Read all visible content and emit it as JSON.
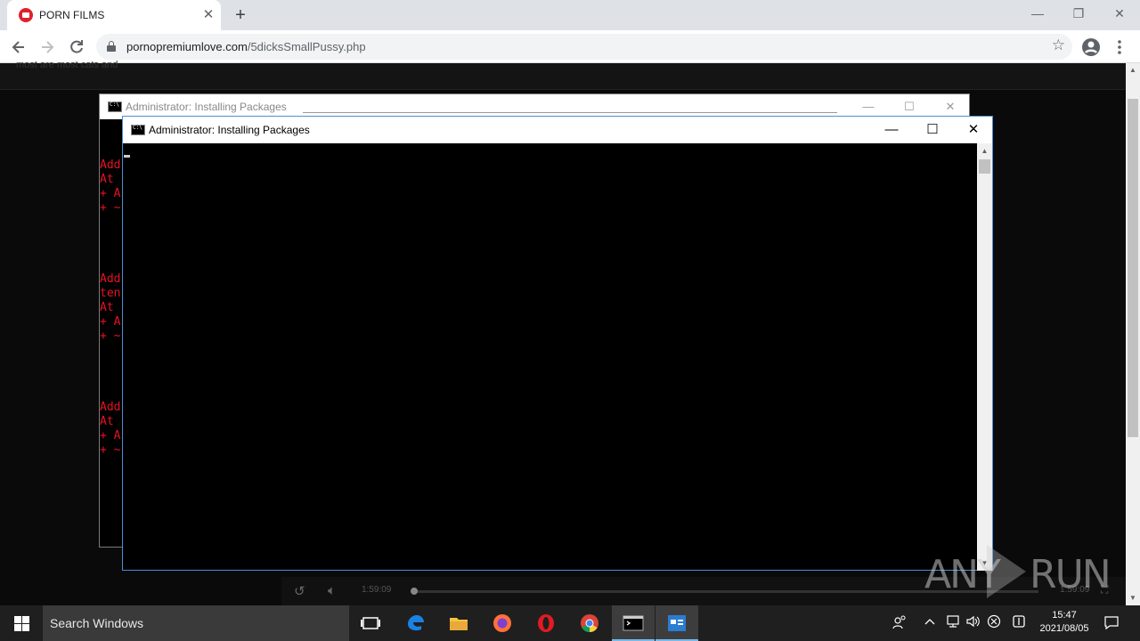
{
  "browser": {
    "tab_title": "PORN FILMS",
    "tab_close": "✕",
    "new_tab": "+",
    "url_host": "pornopremiumlove.com",
    "url_path": "/5dicksSmallPussy.php",
    "window_controls": {
      "minimize": "—",
      "restore": "❐",
      "close": "✕"
    }
  },
  "page": {
    "faint_header": "most are most cats and",
    "video": {
      "time_left": "1:59:09",
      "time_right": "1:59:09"
    }
  },
  "back_console": {
    "title": "Administrator:  Installing Packages",
    "error_lines": [
      "Add",
      "At",
      "+ A",
      "+ ~",
      "",
      "",
      "",
      "",
      "Add",
      "ten",
      "At",
      "+ A",
      "+ ~",
      "",
      "",
      "",
      "",
      "Add",
      "At",
      "+ A",
      "+ ~"
    ],
    "controls": {
      "minimize": "—",
      "maximize": "☐",
      "close": "✕"
    }
  },
  "front_console": {
    "title": "Administrator:  Installing Packages",
    "controls": {
      "minimize": "—",
      "maximize": "☐",
      "close": "✕"
    }
  },
  "watermark": {
    "left": "ANY",
    "right": "RUN"
  },
  "taskbar": {
    "search_placeholder": "Search Windows",
    "time": "15:47",
    "date": "2021/08/05"
  },
  "colors": {
    "error_red": "#e81123",
    "console_border": "#4a8fd6",
    "taskbar": "#1f1f1f"
  }
}
